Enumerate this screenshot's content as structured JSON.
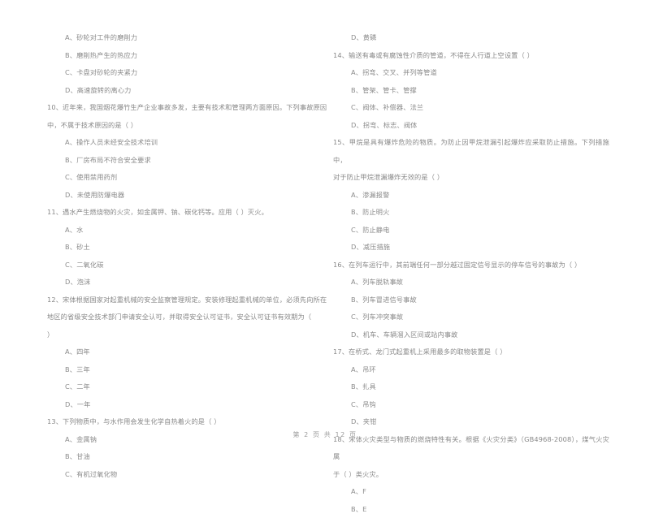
{
  "document": {
    "type": "scanned-exam-paper",
    "language": "zh-CN",
    "footer": "第 2 页 共 12 页"
  },
  "left_column": {
    "orphan_options": [
      "A、砂轮对工件的磨削力",
      "B、磨削热产生的热应力",
      "C、卡盘对砂轮的夹紧力",
      "D、高速旋转的离心力"
    ],
    "questions": [
      {
        "number": "10",
        "stem_line1": "10、近年来，我国烟花爆竹生产企业事故多发，主要有技术和管理两方面原因。下列事故原因",
        "stem_line2": "中，不属于技术原因的是（      ）",
        "options": [
          "A、操作人员未经安全技术培训",
          "B、厂房布局不符合安全要求",
          "C、使用禁用药剂",
          "D、未使用防爆电器"
        ]
      },
      {
        "number": "11",
        "stem_line1": "11、遇水产生燃烧物的火灾，如金属钾、钠、碳化钙等。应用（      ）灭火。",
        "stem_line2": "",
        "options": [
          "A、水",
          "B、砂土",
          "C、二氧化碳",
          "D、泡沫"
        ]
      },
      {
        "number": "12",
        "stem_line1": "12、宋体根据国家对起重机械的安全监察管理规定。安装修理起重机械的单位，必须先向所在",
        "stem_line2": "地区的省级安全技术部门申请安全认可，并取得安全认可证书，安全认可证书有效期为（",
        "stem_line3": "）",
        "options": [
          "A、四年",
          "B、三年",
          "C、二年",
          "D、一年"
        ]
      },
      {
        "number": "13",
        "stem_line1": "13、下列物质中，与水作用会发生化学自热着火的是（      ）",
        "stem_line2": "",
        "options": [
          "A、金属钠",
          "B、甘油",
          "C、有机过氧化物"
        ]
      }
    ]
  },
  "right_column": {
    "orphan_options": [
      "D、黄磷"
    ],
    "questions": [
      {
        "number": "14",
        "stem_line1": "14、输送有毒或有腐蚀性介质的管道，不得在人行道上空设置（      ）",
        "stem_line2": "",
        "options": [
          "A、拐弯、交叉、并列等管道",
          "B、管架、管卡、管撑",
          "C、阀体、补偿器、法兰",
          "D、拐弯、标志、阀体"
        ]
      },
      {
        "number": "15",
        "stem_line1": "15、甲烷是具有爆炸危险的物质。为防止因甲烷泄漏引起爆炸应采取防止措施。下列措施中，",
        "stem_line2": "对于防止甲烷泄漏爆炸无效的是（      ）",
        "options": [
          "A、渗漏报警",
          "B、防止明火",
          "C、防止静电",
          "D、减压措施"
        ]
      },
      {
        "number": "16",
        "stem_line1": "16、在列车运行中，其前端任何一部分越过固定信号显示的停车信号的事故为（      ）",
        "stem_line2": "",
        "options": [
          "A、列车脱轨事故",
          "B、列车冒进信号事故",
          "C、列车冲突事故",
          "D、机车、车辆溜入区间或站内事故"
        ]
      },
      {
        "number": "17",
        "stem_line1": "17、在桥式、龙门式起重机上采用最多的取物装置是（      ）",
        "stem_line2": "",
        "options": [
          "A、吊环",
          "B、扎具",
          "C、吊钩",
          "D、夹钳"
        ]
      },
      {
        "number": "18",
        "stem_line1": "18、宋体火灾类型与物质的燃烧特性有关。根据《火灾分类》（GB4968-2008），煤气火灾属",
        "stem_line2": "于（      ）类火灾。",
        "options": [
          "A、F",
          "B、E"
        ]
      }
    ]
  }
}
